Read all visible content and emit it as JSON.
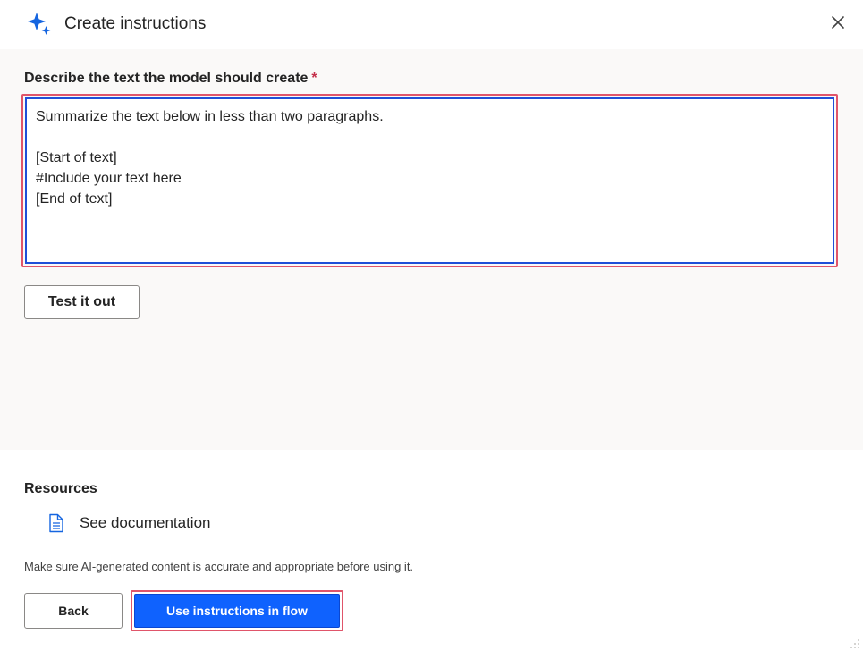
{
  "header": {
    "title": "Create instructions",
    "icon": "sparkle-icon",
    "close_icon": "close-icon",
    "accent_color": "#1f6feb"
  },
  "prompt": {
    "label": "Describe the text the model should create",
    "required_marker": "*",
    "value": "Summarize the text below in less than two paragraphs.\n\n[Start of text]\n#Include your text here\n[End of text]"
  },
  "test_button": {
    "label": "Test it out"
  },
  "resources": {
    "label": "Resources",
    "links": [
      {
        "label": "See documentation",
        "icon": "document-icon"
      }
    ]
  },
  "disclaimer": "Make sure AI-generated content is accurate and appropriate before using it.",
  "footer": {
    "back_label": "Back",
    "primary_label": "Use instructions in flow",
    "primary_color": "#0f62fe"
  },
  "colors": {
    "highlight": "#e0556a",
    "focus": "#1f4fd8",
    "panel_bg": "#faf9f8"
  }
}
